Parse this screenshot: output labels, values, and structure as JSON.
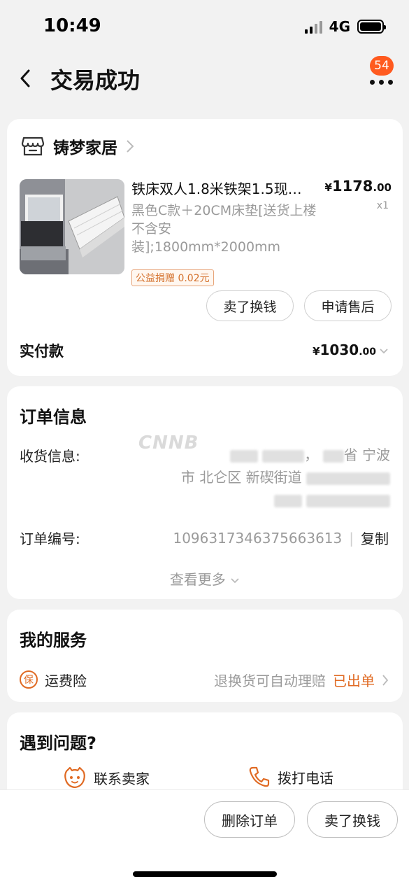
{
  "status": {
    "time": "10:49",
    "network": "4G"
  },
  "nav": {
    "title": "交易成功",
    "badge": "54"
  },
  "shop": {
    "name": "铸梦家居"
  },
  "product": {
    "title": "铁床双人1.8米铁架1.5现…",
    "price_currency": "¥",
    "price_int": "1178",
    "price_dec": ".00",
    "qty": "x1",
    "sku": "黑色C款＋20CM床垫[送货上楼不含安装];1800mm*2000mm",
    "tag": "公益捐赠 0.02元",
    "btn_sell": "卖了换钱",
    "btn_after_sale": "申请售后"
  },
  "payment": {
    "label": "实付款",
    "currency": "¥",
    "amount_int": "1030",
    "amount_dec": ".00"
  },
  "order": {
    "title": "订单信息",
    "receiver_label": "收货信息:",
    "address_part1": "省 宁波",
    "address_part2": "市 北仑区 新碶街道",
    "watermark": "CNNB",
    "order_no_label": "订单编号:",
    "order_no": "1096317346375663613",
    "separator": "|",
    "copy": "复制",
    "see_more": "查看更多"
  },
  "services": {
    "title": "我的服务",
    "icon_char": "保",
    "item_label": "运费险",
    "item_desc": "退换货可自动理赔",
    "item_status": "已出单"
  },
  "problems": {
    "title": "遇到问题?",
    "contact_seller": "联系卖家",
    "call_phone": "拨打电话"
  },
  "bottom": {
    "delete_order": "删除订单",
    "sell": "卖了换钱"
  },
  "colors": {
    "accent": "#e06a23",
    "badge": "#ff5a1f",
    "background": "#f2f2f2"
  }
}
